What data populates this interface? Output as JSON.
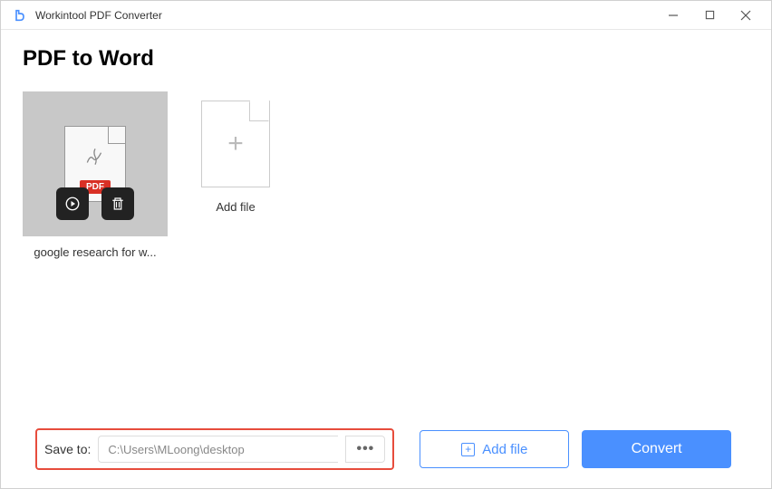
{
  "titlebar": {
    "app_name": "Workintool PDF Converter"
  },
  "page": {
    "title": "PDF to Word"
  },
  "files": [
    {
      "badge": "PDF",
      "name": "google research for w..."
    }
  ],
  "add_tile": {
    "label": "Add file"
  },
  "save": {
    "label": "Save to:",
    "path": "C:\\Users\\MLoong\\desktop",
    "browse": "•••"
  },
  "buttons": {
    "add_file": "Add file",
    "convert": "Convert"
  }
}
